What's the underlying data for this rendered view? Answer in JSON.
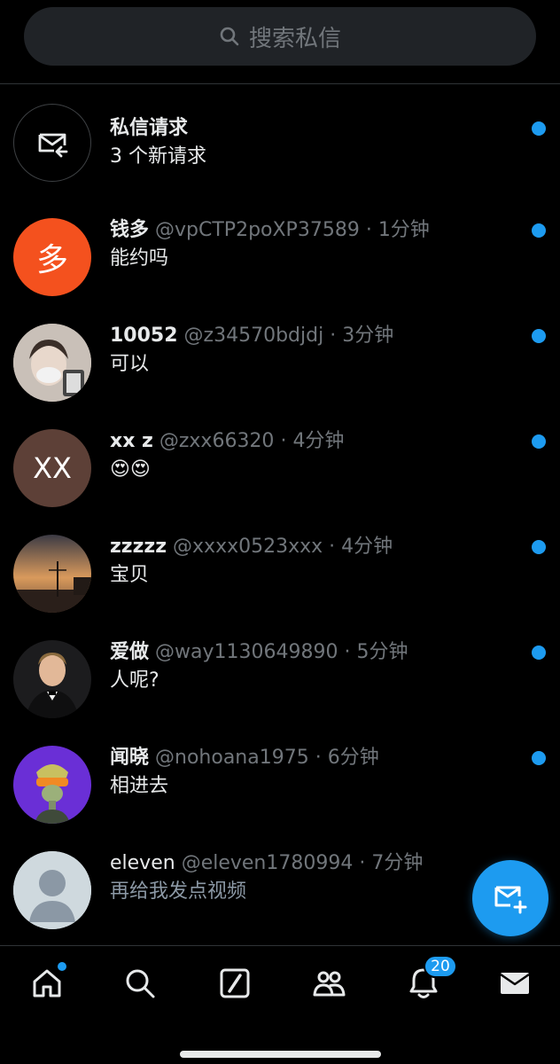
{
  "search": {
    "placeholder": "搜索私信"
  },
  "requests": {
    "title": "私信请求",
    "subtitle": "3 个新请求",
    "unread": true
  },
  "conversations": [
    {
      "name": "钱多",
      "handle": "@vpCTP2poXP37589",
      "time": "1分钟",
      "message": "能约吗",
      "avatar_letter": "多",
      "avatar_color": "#f4511e",
      "unread": true
    },
    {
      "name": "10052",
      "handle": "@z34570bdjdj",
      "time": "3分钟",
      "message": "可以",
      "avatar_letter": "",
      "avatar_color": "#b8ada3",
      "unread": true
    },
    {
      "name": "xx z",
      "handle": "@zxx66320",
      "time": "4分钟",
      "message": "😍😍",
      "avatar_letter": "XX",
      "avatar_color": "#5d4037",
      "unread": true
    },
    {
      "name": "zzzzz",
      "handle": "@xxxx0523xxx",
      "time": "4分钟",
      "message": "宝贝",
      "avatar_letter": "",
      "avatar_color": "#c89060",
      "unread": true
    },
    {
      "name": "爱做",
      "handle": "@way1130649890",
      "time": "5分钟",
      "message": "人呢?",
      "avatar_letter": "",
      "avatar_color": "#2a2a2a",
      "unread": true
    },
    {
      "name": "闻晓",
      "handle": "@nohoana1975",
      "time": "6分钟",
      "message": "相进去",
      "avatar_letter": "",
      "avatar_color": "#6a2fd6",
      "unread": true
    },
    {
      "name": "eleven",
      "handle": "@eleven1780994",
      "time": "7分钟",
      "message": "再给我发点视频",
      "avatar_letter": "",
      "avatar_color": "#cfd9de",
      "unread": false
    }
  ],
  "tabbar": {
    "notifications_badge": "20"
  },
  "colors": {
    "accent": "#1d9bf0",
    "background": "#000000",
    "muted": "#71767b"
  }
}
